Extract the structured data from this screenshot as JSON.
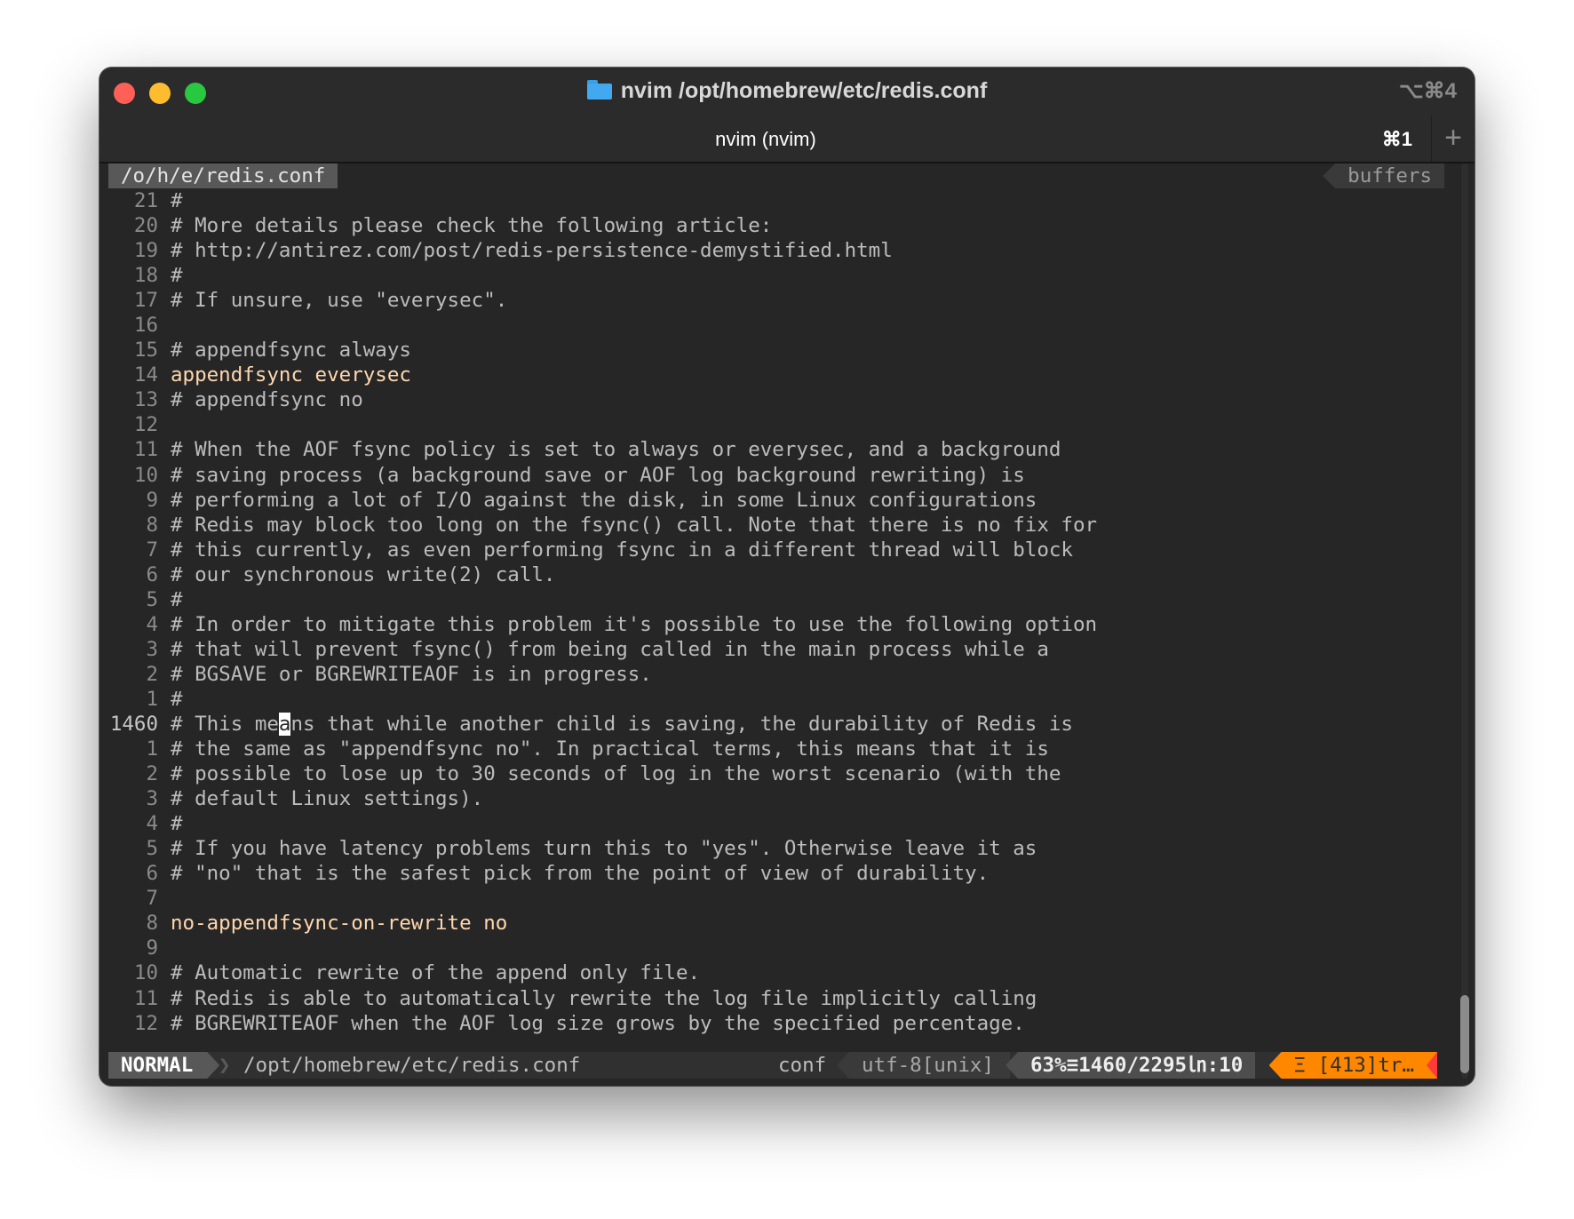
{
  "window": {
    "title": "nvim /opt/homebrew/etc/redis.conf",
    "shortcut": "⌥⌘4",
    "icon": "folder-icon"
  },
  "tab": {
    "label": "nvim (nvim)",
    "shortcut": "⌘1",
    "new_tab_symbol": "+"
  },
  "bufferline": {
    "file": "/o/h/e/redis.conf",
    "buffers_label": "buffers"
  },
  "editor": {
    "lines": [
      {
        "num": "21",
        "text": "#",
        "kw": false
      },
      {
        "num": "20",
        "text": "# More details please check the following article:",
        "kw": false
      },
      {
        "num": "19",
        "text": "# http://antirez.com/post/redis-persistence-demystified.html",
        "kw": false
      },
      {
        "num": "18",
        "text": "#",
        "kw": false
      },
      {
        "num": "17",
        "text": "# If unsure, use \"everysec\".",
        "kw": false
      },
      {
        "num": "16",
        "text": "",
        "kw": false
      },
      {
        "num": "15",
        "text": "# appendfsync always",
        "kw": false
      },
      {
        "num": "14",
        "text": "appendfsync everysec",
        "kw": true
      },
      {
        "num": "13",
        "text": "# appendfsync no",
        "kw": false
      },
      {
        "num": "12",
        "text": "",
        "kw": false
      },
      {
        "num": "11",
        "text": "# When the AOF fsync policy is set to always or everysec, and a background",
        "kw": false
      },
      {
        "num": "10",
        "text": "# saving process (a background save or AOF log background rewriting) is",
        "kw": false
      },
      {
        "num": "9",
        "text": "# performing a lot of I/O against the disk, in some Linux configurations",
        "kw": false
      },
      {
        "num": "8",
        "text": "# Redis may block too long on the fsync() call. Note that there is no fix for",
        "kw": false
      },
      {
        "num": "7",
        "text": "# this currently, as even performing fsync in a different thread will block",
        "kw": false
      },
      {
        "num": "6",
        "text": "# our synchronous write(2) call.",
        "kw": false
      },
      {
        "num": "5",
        "text": "#",
        "kw": false
      },
      {
        "num": "4",
        "text": "# In order to mitigate this problem it's possible to use the following option",
        "kw": false
      },
      {
        "num": "3",
        "text": "# that will prevent fsync() from being called in the main process while a",
        "kw": false
      },
      {
        "num": "2",
        "text": "# BGSAVE or BGREWRITEAOF is in progress.",
        "kw": false
      },
      {
        "num": "1",
        "text": "#",
        "kw": false
      },
      {
        "num": "1460",
        "text": "# This means that while another child is saving, the durability of Redis is",
        "kw": false,
        "current": true,
        "cursor_col": 9
      },
      {
        "num": "1",
        "text": "# the same as \"appendfsync no\". In practical terms, this means that it is",
        "kw": false
      },
      {
        "num": "2",
        "text": "# possible to lose up to 30 seconds of log in the worst scenario (with the",
        "kw": false
      },
      {
        "num": "3",
        "text": "# default Linux settings).",
        "kw": false
      },
      {
        "num": "4",
        "text": "#",
        "kw": false
      },
      {
        "num": "5",
        "text": "# If you have latency problems turn this to \"yes\". Otherwise leave it as",
        "kw": false
      },
      {
        "num": "6",
        "text": "# \"no\" that is the safest pick from the point of view of durability.",
        "kw": false
      },
      {
        "num": "7",
        "text": "",
        "kw": false
      },
      {
        "num": "8",
        "text": "no-appendfsync-on-rewrite no",
        "kw": true
      },
      {
        "num": "9",
        "text": "",
        "kw": false
      },
      {
        "num": "10",
        "text": "# Automatic rewrite of the append only file.",
        "kw": false
      },
      {
        "num": "11",
        "text": "# Redis is able to automatically rewrite the log file implicitly calling",
        "kw": false
      },
      {
        "num": "12",
        "text": "# BGREWRITEAOF when the AOF log size grows by the specified percentage.",
        "kw": false
      }
    ]
  },
  "statusline": {
    "mode": "NORMAL",
    "path": "/opt/homebrew/etc/redis.conf",
    "filetype": "conf",
    "encoding": "utf-8[unix]",
    "position": "63%≡1460/2295㏑:10",
    "warning": "Ξ [413]tr…"
  },
  "scroll": {
    "fraction": 0.63
  },
  "colors": {
    "background": "#262626",
    "keyword": "#ffd7af",
    "warning": "#ff8700",
    "error": "#ff3a3a"
  }
}
